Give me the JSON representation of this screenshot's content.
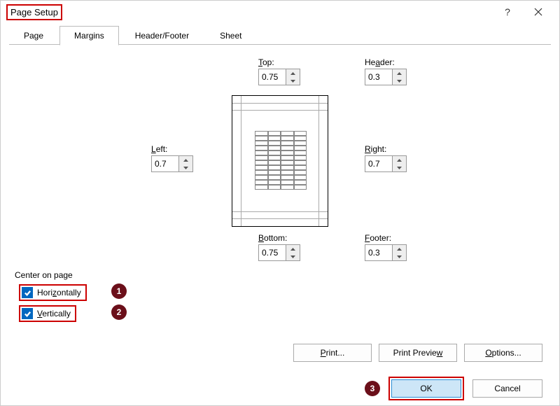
{
  "title": "Page Setup",
  "tabs": {
    "page": "Page",
    "margins": "Margins",
    "headerfooter": "Header/Footer",
    "sheet": "Sheet"
  },
  "margins": {
    "top_label": "Top:",
    "top": "0.75",
    "header_label": "Header:",
    "header": "0.3",
    "left_label": "Left:",
    "left": "0.7",
    "right_label": "Right:",
    "right": "0.7",
    "bottom_label": "Bottom:",
    "bottom": "0.75",
    "footer_label": "Footer:",
    "footer": "0.3"
  },
  "center": {
    "section": "Center on page",
    "hor_pre": "H",
    "hor_rest": "orizontally",
    "ver_pre": "V",
    "ver_rest": "ertically"
  },
  "badges": {
    "hor": "1",
    "ver": "2",
    "ok": "3"
  },
  "buttons": {
    "print_pre": "P",
    "print_rest": "rint...",
    "preview_pre": "Print Previe",
    "preview_rest": "w",
    "preview_u": "w",
    "print_preview": "Print Preview",
    "options_pre": "O",
    "options_rest": "ptions...",
    "ok": "OK",
    "cancel": "Cancel"
  }
}
